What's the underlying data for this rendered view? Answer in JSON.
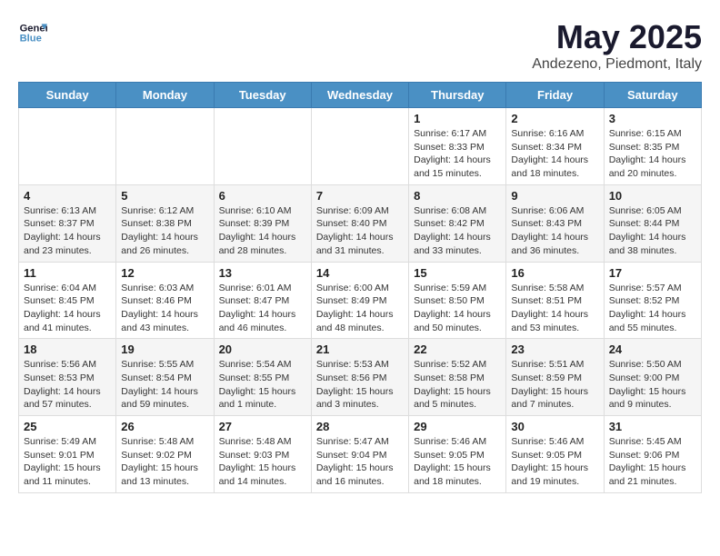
{
  "header": {
    "logo_line1": "General",
    "logo_line2": "Blue",
    "title": "May 2025",
    "subtitle": "Andezeno, Piedmont, Italy"
  },
  "days_of_week": [
    "Sunday",
    "Monday",
    "Tuesday",
    "Wednesday",
    "Thursday",
    "Friday",
    "Saturday"
  ],
  "weeks": [
    [
      {
        "day": "",
        "info": ""
      },
      {
        "day": "",
        "info": ""
      },
      {
        "day": "",
        "info": ""
      },
      {
        "day": "",
        "info": ""
      },
      {
        "day": "1",
        "info": "Sunrise: 6:17 AM\nSunset: 8:33 PM\nDaylight: 14 hours\nand 15 minutes."
      },
      {
        "day": "2",
        "info": "Sunrise: 6:16 AM\nSunset: 8:34 PM\nDaylight: 14 hours\nand 18 minutes."
      },
      {
        "day": "3",
        "info": "Sunrise: 6:15 AM\nSunset: 8:35 PM\nDaylight: 14 hours\nand 20 minutes."
      }
    ],
    [
      {
        "day": "4",
        "info": "Sunrise: 6:13 AM\nSunset: 8:37 PM\nDaylight: 14 hours\nand 23 minutes."
      },
      {
        "day": "5",
        "info": "Sunrise: 6:12 AM\nSunset: 8:38 PM\nDaylight: 14 hours\nand 26 minutes."
      },
      {
        "day": "6",
        "info": "Sunrise: 6:10 AM\nSunset: 8:39 PM\nDaylight: 14 hours\nand 28 minutes."
      },
      {
        "day": "7",
        "info": "Sunrise: 6:09 AM\nSunset: 8:40 PM\nDaylight: 14 hours\nand 31 minutes."
      },
      {
        "day": "8",
        "info": "Sunrise: 6:08 AM\nSunset: 8:42 PM\nDaylight: 14 hours\nand 33 minutes."
      },
      {
        "day": "9",
        "info": "Sunrise: 6:06 AM\nSunset: 8:43 PM\nDaylight: 14 hours\nand 36 minutes."
      },
      {
        "day": "10",
        "info": "Sunrise: 6:05 AM\nSunset: 8:44 PM\nDaylight: 14 hours\nand 38 minutes."
      }
    ],
    [
      {
        "day": "11",
        "info": "Sunrise: 6:04 AM\nSunset: 8:45 PM\nDaylight: 14 hours\nand 41 minutes."
      },
      {
        "day": "12",
        "info": "Sunrise: 6:03 AM\nSunset: 8:46 PM\nDaylight: 14 hours\nand 43 minutes."
      },
      {
        "day": "13",
        "info": "Sunrise: 6:01 AM\nSunset: 8:47 PM\nDaylight: 14 hours\nand 46 minutes."
      },
      {
        "day": "14",
        "info": "Sunrise: 6:00 AM\nSunset: 8:49 PM\nDaylight: 14 hours\nand 48 minutes."
      },
      {
        "day": "15",
        "info": "Sunrise: 5:59 AM\nSunset: 8:50 PM\nDaylight: 14 hours\nand 50 minutes."
      },
      {
        "day": "16",
        "info": "Sunrise: 5:58 AM\nSunset: 8:51 PM\nDaylight: 14 hours\nand 53 minutes."
      },
      {
        "day": "17",
        "info": "Sunrise: 5:57 AM\nSunset: 8:52 PM\nDaylight: 14 hours\nand 55 minutes."
      }
    ],
    [
      {
        "day": "18",
        "info": "Sunrise: 5:56 AM\nSunset: 8:53 PM\nDaylight: 14 hours\nand 57 minutes."
      },
      {
        "day": "19",
        "info": "Sunrise: 5:55 AM\nSunset: 8:54 PM\nDaylight: 14 hours\nand 59 minutes."
      },
      {
        "day": "20",
        "info": "Sunrise: 5:54 AM\nSunset: 8:55 PM\nDaylight: 15 hours\nand 1 minute."
      },
      {
        "day": "21",
        "info": "Sunrise: 5:53 AM\nSunset: 8:56 PM\nDaylight: 15 hours\nand 3 minutes."
      },
      {
        "day": "22",
        "info": "Sunrise: 5:52 AM\nSunset: 8:58 PM\nDaylight: 15 hours\nand 5 minutes."
      },
      {
        "day": "23",
        "info": "Sunrise: 5:51 AM\nSunset: 8:59 PM\nDaylight: 15 hours\nand 7 minutes."
      },
      {
        "day": "24",
        "info": "Sunrise: 5:50 AM\nSunset: 9:00 PM\nDaylight: 15 hours\nand 9 minutes."
      }
    ],
    [
      {
        "day": "25",
        "info": "Sunrise: 5:49 AM\nSunset: 9:01 PM\nDaylight: 15 hours\nand 11 minutes."
      },
      {
        "day": "26",
        "info": "Sunrise: 5:48 AM\nSunset: 9:02 PM\nDaylight: 15 hours\nand 13 minutes."
      },
      {
        "day": "27",
        "info": "Sunrise: 5:48 AM\nSunset: 9:03 PM\nDaylight: 15 hours\nand 14 minutes."
      },
      {
        "day": "28",
        "info": "Sunrise: 5:47 AM\nSunset: 9:04 PM\nDaylight: 15 hours\nand 16 minutes."
      },
      {
        "day": "29",
        "info": "Sunrise: 5:46 AM\nSunset: 9:05 PM\nDaylight: 15 hours\nand 18 minutes."
      },
      {
        "day": "30",
        "info": "Sunrise: 5:46 AM\nSunset: 9:05 PM\nDaylight: 15 hours\nand 19 minutes."
      },
      {
        "day": "31",
        "info": "Sunrise: 5:45 AM\nSunset: 9:06 PM\nDaylight: 15 hours\nand 21 minutes."
      }
    ]
  ]
}
